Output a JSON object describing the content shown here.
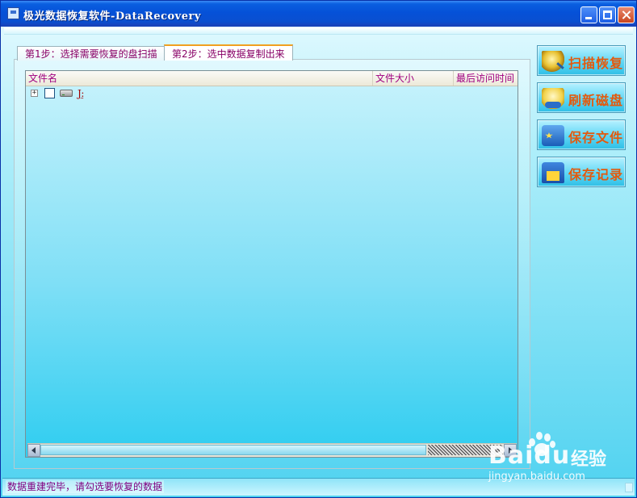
{
  "window": {
    "title": "极光数据恢复软件-DataRecovery",
    "controls": {
      "minimize": "minimize",
      "maximize": "maximize",
      "close": "close"
    }
  },
  "tabs": [
    {
      "label": "第1步：选择需要恢复的盘扫描",
      "active": false
    },
    {
      "label": "第2步：选中数据复制出来",
      "active": true
    }
  ],
  "file_list": {
    "columns": [
      "文件名",
      "文件大小",
      "最后访问时间"
    ],
    "rows": [
      {
        "expand": "+",
        "checked": false,
        "icon": "drive-icon",
        "name": "J:"
      }
    ]
  },
  "side_buttons": [
    {
      "label": "扫描恢复",
      "icon": "magnifier-icon"
    },
    {
      "label": "刷新磁盘",
      "icon": "refresh-disk-icon"
    },
    {
      "label": "保存文件",
      "icon": "save-file-icon"
    },
    {
      "label": "保存记录",
      "icon": "save-record-icon"
    }
  ],
  "status": {
    "text": "数据重建完毕，请勾选要恢复的数据"
  },
  "watermark": {
    "brand": "Bai",
    "brand2": "du",
    "cn": "经验",
    "url": "jingyan.baidu.com"
  },
  "colors": {
    "title_bar": "#0551d8",
    "accent_orange": "#e35a0e",
    "label_purple": "#a00080",
    "body_cyan": "#4fd2f0"
  }
}
